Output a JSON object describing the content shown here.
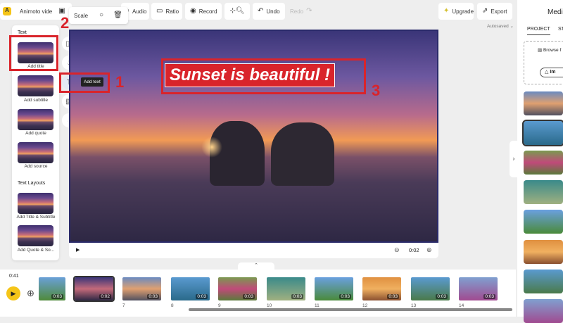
{
  "toolbar": {
    "project_name": "Animoto video",
    "scale": "Scale",
    "audio": "Audio",
    "ratio": "Ratio",
    "record": "Record",
    "undo": "Undo",
    "redo": "Redo",
    "upgrade": "Upgrade",
    "export": "Export",
    "autosaved": "Autosaved"
  },
  "text_panel": {
    "section_text": "Text",
    "items": [
      "Add title",
      "Add subtitle",
      "Add quote",
      "Add source"
    ],
    "section_layouts": "Text Layouts",
    "layouts": [
      "Add Title & Subtitle",
      "Add Quote & So..."
    ]
  },
  "tooltip": "Add text",
  "canvas": {
    "title_text": "Sunset is beautiful !",
    "time": "0:02"
  },
  "annotations": {
    "one": "1",
    "two": "2",
    "three": "3"
  },
  "timeline": {
    "total": "0:41",
    "clips": [
      {
        "num": "",
        "dur": "0:03"
      },
      {
        "num": "",
        "dur": "0:02"
      },
      {
        "num": "7",
        "dur": "0:03"
      },
      {
        "num": "8",
        "dur": "0:03"
      },
      {
        "num": "9",
        "dur": "0:03"
      },
      {
        "num": "10",
        "dur": "0:03"
      },
      {
        "num": "11",
        "dur": "0:03"
      },
      {
        "num": "12",
        "dur": "0:03"
      },
      {
        "num": "13",
        "dur": "0:03"
      },
      {
        "num": "14",
        "dur": "0:03"
      }
    ]
  },
  "media": {
    "title": "Media",
    "tabs": [
      "PROJECT",
      "ST"
    ],
    "browse": "Browse f",
    "import": "Im"
  },
  "colors": {
    "accent": "#f5c518",
    "annotation": "#d9242b"
  }
}
